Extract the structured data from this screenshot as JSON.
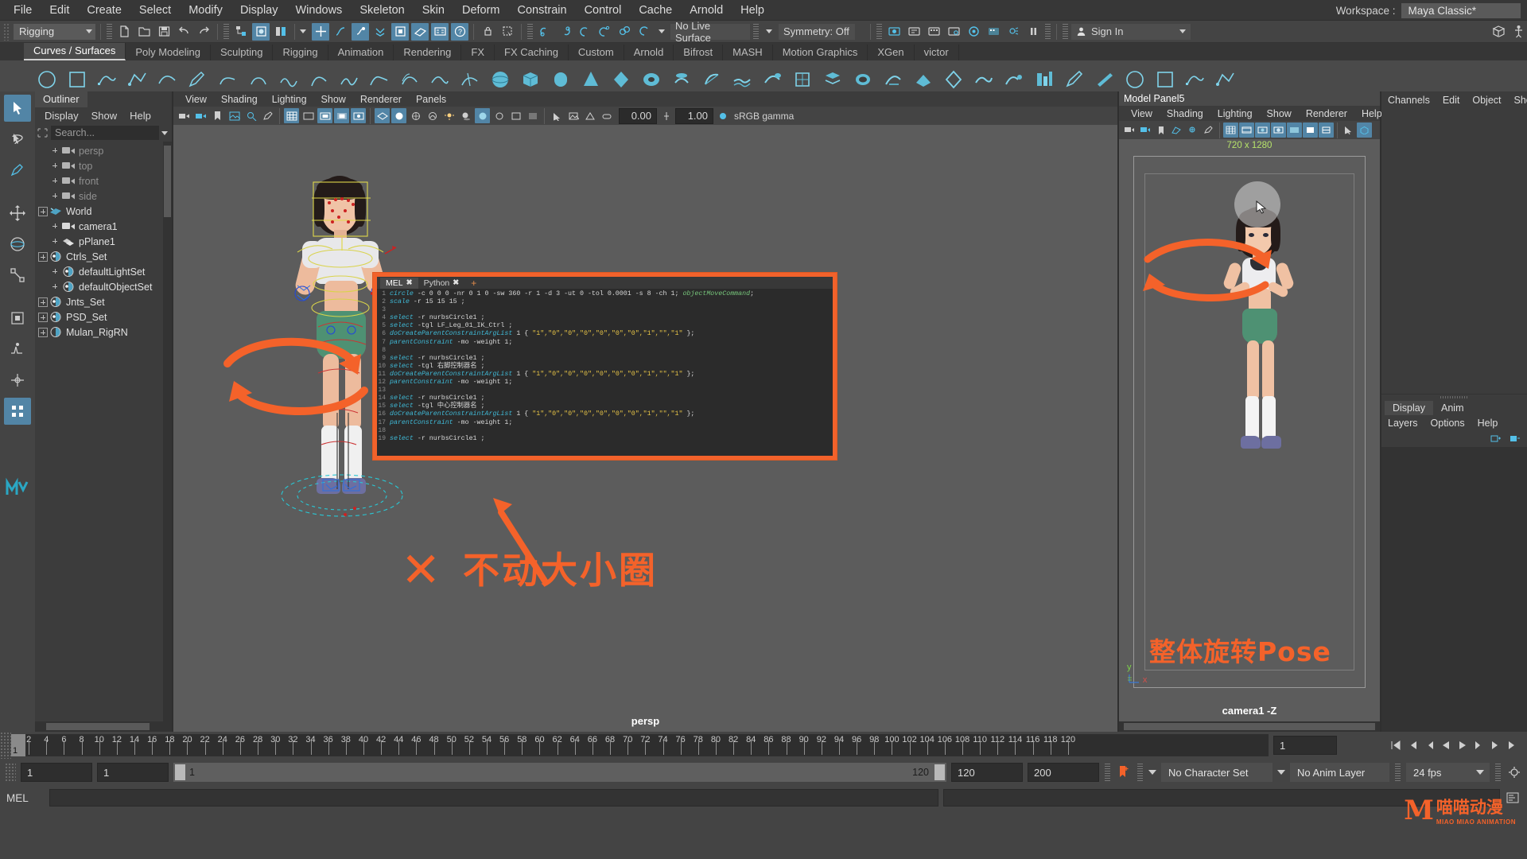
{
  "menubar": {
    "items": [
      "File",
      "Edit",
      "Create",
      "Select",
      "Modify",
      "Display",
      "Windows",
      "Skeleton",
      "Skin",
      "Deform",
      "Constrain",
      "Control",
      "Cache",
      "Arnold",
      "Help"
    ],
    "workspace_label": "Workspace :",
    "workspace_value": "Maya Classic*"
  },
  "statusbar": {
    "menuset": "Rigging",
    "live_surface": "No Live Surface",
    "symmetry": "Symmetry: Off",
    "snap_value_1": "0.00",
    "snap_value_2": "1.00",
    "gamma": "sRGB gamma",
    "signin": "Sign In",
    "icons": [
      "new-scene-icon",
      "open-scene-icon",
      "save-scene-icon",
      "undo-icon",
      "redo-icon",
      "select-hierarchy-icon",
      "select-object-icon",
      "select-component-icon",
      "snap-grid-icon",
      "snap-curve-icon",
      "snap-point-icon",
      "snap-projected-icon",
      "snap-view-plane-icon",
      "make-live-icon",
      "lock-icon",
      "render-current-frame-icon",
      "ipr-render-icon",
      "render-settings-icon",
      "hypershade-icon",
      "render-view-icon",
      "light-editor-icon",
      "pause-icon"
    ]
  },
  "shelf": {
    "tabs": [
      "Curves / Surfaces",
      "Poly Modeling",
      "Sculpting",
      "Rigging",
      "Animation",
      "Rendering",
      "FX",
      "FX Caching",
      "Custom",
      "Arnold",
      "Bifrost",
      "MASH",
      "Motion Graphics",
      "XGen",
      "victor"
    ],
    "active_tab": "Curves / Surfaces",
    "buttons": [
      "nurbs-circle-icon",
      "nurbs-square-icon",
      "cv-curve-icon",
      "ep-curve-icon",
      "bezier-curve-icon",
      "pencil-curve-icon",
      "arc-three-point-icon",
      "curve-fillet-icon",
      "attach-curves-icon",
      "detach-curves-icon",
      "insert-knot-icon",
      "extend-curve-icon",
      "offset-curve-icon",
      "rebuild-curve-icon",
      "cut-curve-icon",
      "sphere-icon",
      "cube-icon",
      "cylinder-icon",
      "cone-icon",
      "torus-icon",
      "plane-icon",
      "revolve-icon",
      "loft-icon",
      "planar-icon",
      "extrude-icon",
      "birail-icon",
      "boundary-icon",
      "square-surface-icon",
      "bevel-icon",
      "bevel-plus-icon",
      "intersect-surfaces-icon",
      "project-curve-icon",
      "trim-tool-icon",
      "untrim-icon",
      "attach-surfaces-icon",
      "detach-surfaces-icon",
      "align-surfaces-icon",
      "surface-fillet-icon",
      "sculpt-geometry-icon",
      "surface-editor-icon"
    ]
  },
  "lefttoolbar": {
    "tools": [
      "select-tool",
      "lasso-select-tool",
      "paint-select-tool",
      "move-tool",
      "rotate-tool",
      "scale-tool",
      "universal-manipulator",
      "soft-modification-tool",
      "show-manipulator-tool",
      "last-tool-used",
      "snap-together-tool",
      "component-editor",
      "quick-rig-tool"
    ]
  },
  "outliner": {
    "title": "Outliner",
    "menus": [
      "Display",
      "Show",
      "Help"
    ],
    "search_placeholder": "Search...",
    "items": [
      {
        "label": "persp",
        "icon": "camera-icon",
        "indent": 1,
        "dim": true,
        "expand": false
      },
      {
        "label": "top",
        "icon": "camera-icon",
        "indent": 1,
        "dim": true,
        "expand": false
      },
      {
        "label": "front",
        "icon": "camera-icon",
        "indent": 1,
        "dim": true,
        "expand": false
      },
      {
        "label": "side",
        "icon": "camera-icon",
        "indent": 1,
        "dim": true,
        "expand": false
      },
      {
        "label": "World",
        "icon": "transform-icon",
        "indent": 0,
        "dim": false,
        "expand": true
      },
      {
        "label": "camera1",
        "icon": "camera-icon",
        "indent": 1,
        "dim": false,
        "expand": false
      },
      {
        "label": "pPlane1",
        "icon": "mesh-icon",
        "indent": 1,
        "dim": false,
        "expand": false
      },
      {
        "label": "Ctrls_Set",
        "icon": "set-icon",
        "indent": 0,
        "dim": false,
        "expand": true
      },
      {
        "label": "defaultLightSet",
        "icon": "set-icon",
        "indent": 1,
        "dim": false,
        "expand": false
      },
      {
        "label": "defaultObjectSet",
        "icon": "set-icon",
        "indent": 1,
        "dim": false,
        "expand": false
      },
      {
        "label": "Jnts_Set",
        "icon": "set-icon",
        "indent": 0,
        "dim": false,
        "expand": true
      },
      {
        "label": "PSD_Set",
        "icon": "set-icon",
        "indent": 0,
        "dim": false,
        "expand": true
      },
      {
        "label": "Mulan_RigRN",
        "icon": "reference-icon",
        "indent": 0,
        "dim": false,
        "expand": true
      }
    ]
  },
  "viewport_left": {
    "menus": [
      "View",
      "Shading",
      "Lighting",
      "Show",
      "Renderer",
      "Panels"
    ],
    "field_1": "0.00",
    "field_2": "1.00",
    "colorspace": "sRGB gamma",
    "camera_label": "persp"
  },
  "viewport_right": {
    "panel_title": "Model Panel5",
    "menus": [
      "View",
      "Shading",
      "Lighting",
      "Show",
      "Renderer",
      "Help"
    ],
    "resolution": "720 x 1280",
    "camera_label": "camera1 -Z",
    "axis_labels": [
      "y",
      "x"
    ]
  },
  "script_editor": {
    "tabs": [
      {
        "label": "MEL",
        "active": true
      },
      {
        "label": "Python",
        "active": false
      }
    ],
    "add_tab": "+",
    "close_glyph": "✖",
    "lines": [
      {
        "n": "1",
        "parts": [
          {
            "t": "circle",
            "c": "cmd"
          },
          {
            "t": " -c 0 0 0 -nr 0 1 0 -sw 360 -r 1 -d 3 -ut 0 -tol 0.0001 -s 8 -ch 1; ",
            "c": ""
          },
          {
            "t": "objectMoveCommand",
            "c": "obj"
          },
          {
            "t": ";",
            "c": ""
          }
        ]
      },
      {
        "n": "2",
        "parts": [
          {
            "t": "scale",
            "c": "cmd"
          },
          {
            "t": " -r 15 15 15 ;",
            "c": ""
          }
        ]
      },
      {
        "n": "3",
        "parts": []
      },
      {
        "n": "4",
        "parts": [
          {
            "t": "select",
            "c": "cmd"
          },
          {
            "t": " -r nurbsCircle1 ;",
            "c": ""
          }
        ]
      },
      {
        "n": "5",
        "parts": [
          {
            "t": "select",
            "c": "cmd"
          },
          {
            "t": " -tgl LF_Leg_01_IK_Ctrl ;",
            "c": ""
          }
        ]
      },
      {
        "n": "6",
        "parts": [
          {
            "t": "doCreateParentConstraintArgList",
            "c": "cmd"
          },
          {
            "t": " 1 { ",
            "c": ""
          },
          {
            "t": "\"1\",\"0\",\"0\",\"0\",\"0\",\"0\",\"0\",\"1\",\"\",\"1\"",
            "c": "str"
          },
          {
            "t": " };",
            "c": ""
          }
        ]
      },
      {
        "n": "7",
        "parts": [
          {
            "t": "parentConstraint",
            "c": "cmd"
          },
          {
            "t": " -mo -weight 1;",
            "c": ""
          }
        ]
      },
      {
        "n": "8",
        "parts": []
      },
      {
        "n": "9",
        "parts": [
          {
            "t": "select",
            "c": "cmd"
          },
          {
            "t": " -r nurbsCircle1 ;",
            "c": ""
          }
        ]
      },
      {
        "n": "10",
        "parts": [
          {
            "t": "select",
            "c": "cmd"
          },
          {
            "t": " -tgl 右脚控制器名 ;",
            "c": ""
          }
        ]
      },
      {
        "n": "11",
        "parts": [
          {
            "t": "doCreateParentConstraintArgList",
            "c": "cmd"
          },
          {
            "t": " 1 { ",
            "c": ""
          },
          {
            "t": "\"1\",\"0\",\"0\",\"0\",\"0\",\"0\",\"0\",\"1\",\"\",\"1\"",
            "c": "str"
          },
          {
            "t": " };",
            "c": ""
          }
        ]
      },
      {
        "n": "12",
        "parts": [
          {
            "t": "parentConstraint",
            "c": "cmd"
          },
          {
            "t": " -mo -weight 1;",
            "c": ""
          }
        ]
      },
      {
        "n": "13",
        "parts": []
      },
      {
        "n": "14",
        "parts": [
          {
            "t": "select",
            "c": "cmd"
          },
          {
            "t": " -r nurbsCircle1 ;",
            "c": ""
          }
        ]
      },
      {
        "n": "15",
        "parts": [
          {
            "t": "select",
            "c": "cmd"
          },
          {
            "t": " -tgl 中心控制器名 ;",
            "c": ""
          }
        ]
      },
      {
        "n": "16",
        "parts": [
          {
            "t": "doCreateParentConstraintArgList",
            "c": "cmd"
          },
          {
            "t": " 1 { ",
            "c": ""
          },
          {
            "t": "\"1\",\"0\",\"0\",\"0\",\"0\",\"0\",\"0\",\"1\",\"\",\"1\"",
            "c": "str"
          },
          {
            "t": " };",
            "c": ""
          }
        ]
      },
      {
        "n": "17",
        "parts": [
          {
            "t": "parentConstraint",
            "c": "cmd"
          },
          {
            "t": " -mo -weight 1;",
            "c": ""
          }
        ]
      },
      {
        "n": "18",
        "parts": []
      },
      {
        "n": "19",
        "parts": [
          {
            "t": "select",
            "c": "cmd"
          },
          {
            "t": " -r nurbsCircle1 ;",
            "c": ""
          }
        ]
      }
    ]
  },
  "annotations": {
    "left_text": "不动大小圈",
    "right_text": "整体旋转Pose",
    "cross_glyph": "✕",
    "accent": "#f4622a"
  },
  "rightdock": {
    "tabs": [
      "Channels",
      "Edit",
      "Object",
      "Show"
    ],
    "layer_tabs": [
      "Display",
      "Anim"
    ],
    "layer_menus": [
      "Layers",
      "Options",
      "Help"
    ]
  },
  "timeline": {
    "ticks": [
      2,
      4,
      6,
      8,
      10,
      12,
      14,
      16,
      18,
      20,
      22,
      24,
      26,
      28,
      30,
      32,
      34,
      36,
      38,
      40,
      42,
      44,
      46,
      48,
      50,
      52,
      54,
      56,
      58,
      60,
      62,
      64,
      66,
      68,
      70,
      72,
      74,
      76,
      78,
      80,
      82,
      84,
      86,
      88,
      90,
      92,
      94,
      96,
      98,
      100,
      102,
      104,
      106,
      108,
      110,
      112,
      114,
      116,
      118,
      120
    ],
    "current_frame": "1",
    "frame_field": "1",
    "range_start": "1",
    "range_start2": "1",
    "slider_start": "1",
    "slider_end": "120",
    "anim_end": "120",
    "playback_end": "200",
    "character_set": "No Character Set",
    "anim_layer": "No Anim Layer",
    "fps": "24 fps"
  },
  "commandline": {
    "label": "MEL",
    "value": "",
    "help_text": ""
  },
  "branding": {
    "mark": "M",
    "cn": "喵喵动漫",
    "en": "MIAO  MIAO  ANIMATION"
  }
}
